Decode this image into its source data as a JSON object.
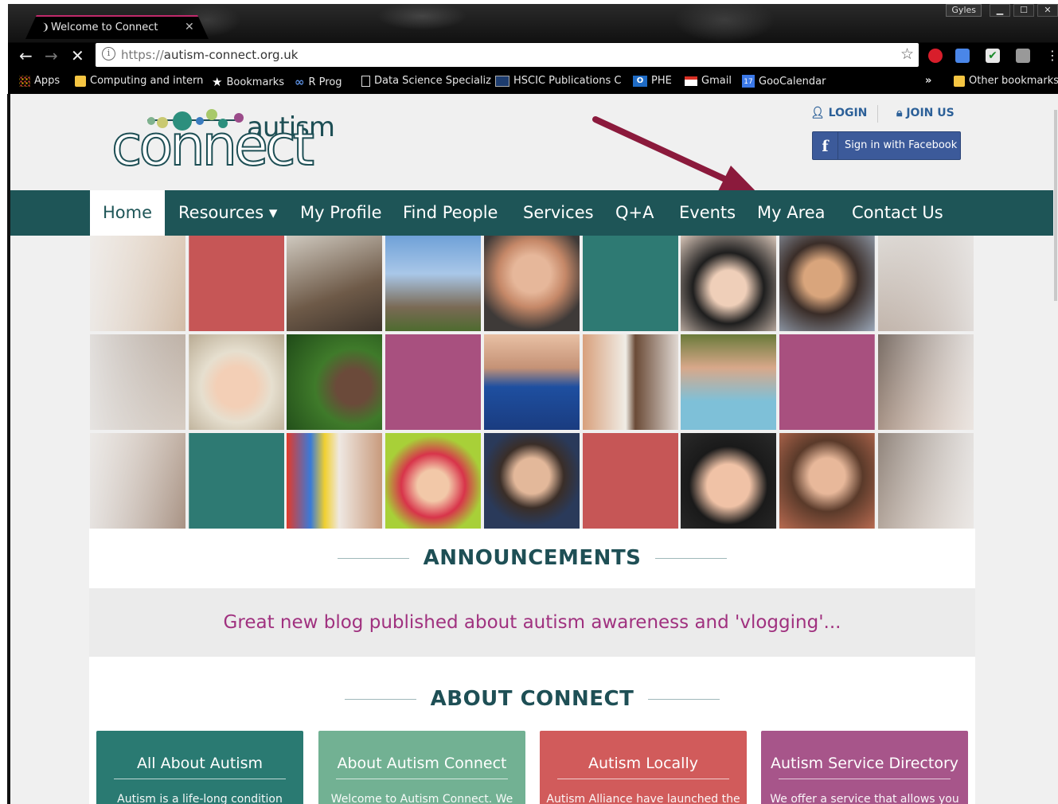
{
  "browser": {
    "tab_title": "Welcome to Connect",
    "tab_icon": "loading-spinner-icon",
    "profile_name": "Gyles",
    "url_scheme": "https://",
    "url_host": "autism-connect.org.uk",
    "bookmarks": [
      {
        "label": "Apps",
        "icon": "apps-grid-icon"
      },
      {
        "label": "Computing and intern",
        "icon": "folder-icon"
      },
      {
        "label": "Bookmarks",
        "icon": "star-icon"
      },
      {
        "label": "R Prog",
        "icon": "infinity-icon"
      },
      {
        "label": "Data Science Specializ",
        "icon": "page-icon"
      },
      {
        "label": "HSCIC Publications C",
        "icon": "monitor-icon"
      },
      {
        "label": "PHE",
        "icon": "outlook-icon"
      },
      {
        "label": "Gmail",
        "icon": "gmail-icon"
      },
      {
        "label": "GooCalendar",
        "icon": "calendar-icon"
      }
    ],
    "overflow_label": "»",
    "other_bookmarks": "Other bookmarks",
    "calendar_day": "17",
    "outlook_badge": "O"
  },
  "header": {
    "logo_top": "autism",
    "logo_bottom": "connect",
    "login_label": "LOGIN",
    "join_label": "JOIN US",
    "facebook_label": "Sign in with Facebook",
    "facebook_icon_text": "f"
  },
  "nav": [
    {
      "label": "Home",
      "active": true
    },
    {
      "label": "Resources ▾",
      "active": false
    },
    {
      "label": "My Profile",
      "active": false
    },
    {
      "label": "Find People",
      "active": false
    },
    {
      "label": "Services",
      "active": false
    },
    {
      "label": "Q+A",
      "active": false
    },
    {
      "label": "Events",
      "active": false
    },
    {
      "label": "My Area",
      "active": false
    },
    {
      "label": "Contact Us",
      "active": false
    }
  ],
  "annotation": {
    "arrow_color": "#8b1a3c",
    "points_to": "My Area"
  },
  "mosaic": {
    "colors": {
      "red": "#c65656",
      "teal": "#2e7a73",
      "purple": "#a8507f"
    }
  },
  "announcements": {
    "heading": "ANNOUNCEMENTS",
    "headline": "Great new blog published about autism awareness and 'vlogging'..."
  },
  "about": {
    "heading": "ABOUT CONNECT",
    "cards": [
      {
        "title": "All About Autism",
        "text": "Autism is a life-long condition",
        "color": "#2a7a72"
      },
      {
        "title": "About Autism Connect",
        "text": "Welcome to Autism Connect. We",
        "color": "#72b193"
      },
      {
        "title": "Autism Locally",
        "text": "Autism Alliance have launched the",
        "color": "#d15b5b"
      },
      {
        "title": "Autism Service Directory",
        "text": "We offer a service that allows you",
        "color": "#a7558a"
      }
    ]
  }
}
